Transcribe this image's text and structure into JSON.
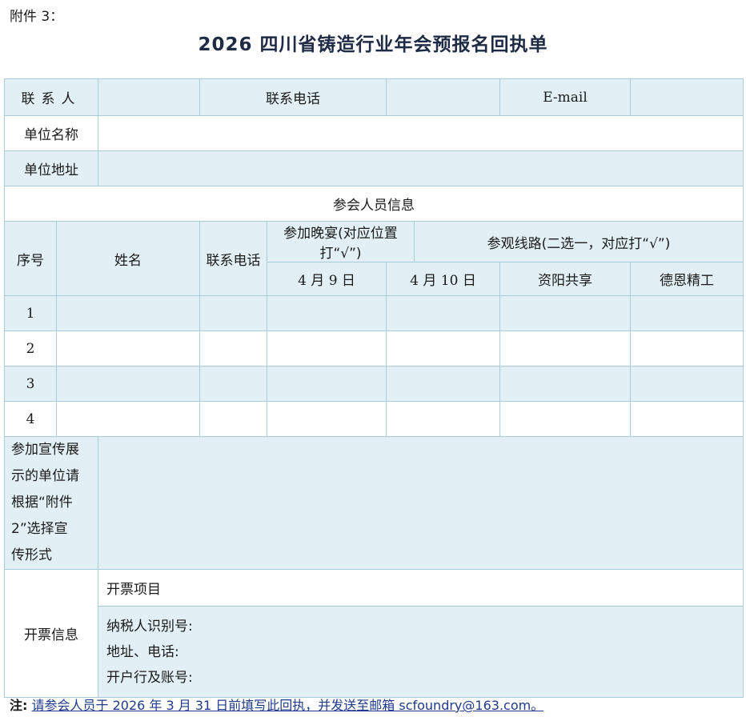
{
  "attachment_label": "附件 3：",
  "title": "2026  四川省铸造行业年会预报名回执单",
  "contact": {
    "contact_person": "联系人",
    "phone": "联系电话",
    "email": "E-mail"
  },
  "unit_name": "单位名称",
  "unit_address": "单位地址",
  "attendee_section": "参会人员信息",
  "headers": {
    "seq": "序号",
    "name": "姓名",
    "phone": "联系电话",
    "dinner": "参加晚宴(对应位置打“√”)",
    "route": "参观线路(二选一，对应打“√”)",
    "date1": "4 月 9 日",
    "date2": "4 月 10 日",
    "route1": "资阳共享",
    "route2": "德恩精工"
  },
  "rows": [
    "1",
    "2",
    "3",
    "4"
  ],
  "promo_lines": [
    "参加宣传展",
    "示的单位请",
    "根据“附件",
    "2”选择宣",
    "传形式"
  ],
  "invoice": {
    "label": "开票信息",
    "item": "开票项目",
    "lines": [
      "纳税人识别号:",
      "地址、电话:",
      "开户行及账号:"
    ]
  },
  "note": {
    "label": "注:",
    "text": "请参会人员于 2026 年 3 月 31 日前填写此回执，并发送至邮箱 scfoundry@163.com。"
  }
}
